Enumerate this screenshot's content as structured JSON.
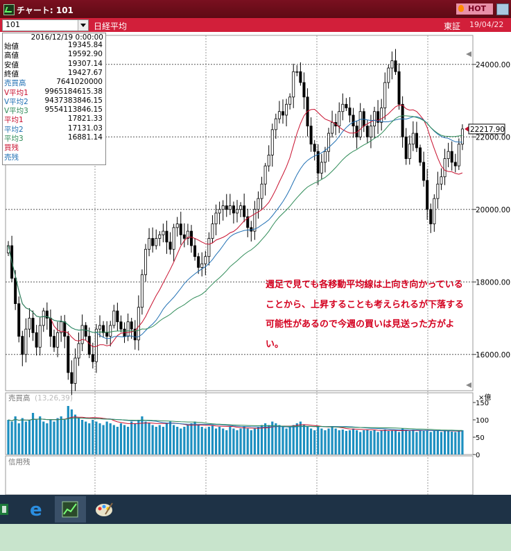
{
  "window": {
    "title": "チャート: 101",
    "hot_label": "HOT",
    "symbol_code": "101",
    "symbol_name": "日経平均",
    "exchange": "東証",
    "date": "19/04/22"
  },
  "info_box": {
    "datetime": "2016/12/19  0:00:00",
    "rows": [
      {
        "label": "始値",
        "value": "19345.84",
        "color": "#000000"
      },
      {
        "label": "高値",
        "value": "19592.90",
        "color": "#000000"
      },
      {
        "label": "安値",
        "value": "19307.14",
        "color": "#000000"
      },
      {
        "label": "終値",
        "value": "19427.67",
        "color": "#000000"
      },
      {
        "label": "売買高",
        "value": "7641020000",
        "color": "#1f6fb3"
      },
      {
        "label": "V平均1",
        "value": "9965184615.38",
        "color": "#c8102e"
      },
      {
        "label": "V平均2",
        "value": "9437383846.15",
        "color": "#1f6fb3"
      },
      {
        "label": "V平均3",
        "value": "9554113846.15",
        "color": "#2e8b57"
      },
      {
        "label": "平均1",
        "value": "17821.33",
        "color": "#c8102e"
      },
      {
        "label": "平均2",
        "value": "17131.03",
        "color": "#1f6fb3"
      },
      {
        "label": "平均3",
        "value": "16881.14",
        "color": "#2e8b57"
      },
      {
        "label": "買残",
        "value": "",
        "color": "#c8102e"
      },
      {
        "label": "売残",
        "value": "",
        "color": "#1f6fb3"
      }
    ]
  },
  "price_axis": {
    "ticks": [
      "24000.00",
      "22000.00",
      "20000.00",
      "18000.00",
      "16000.00"
    ],
    "current_price": "22217.90"
  },
  "volume_pane": {
    "label": "売買高",
    "params": "(13,26,39)",
    "unit": "×億",
    "ticks": [
      "150",
      "100",
      "50",
      "0"
    ]
  },
  "margin_pane": {
    "label": "信用残"
  },
  "annotation": "週足で見ても各移動平均線は上向き向かっていることから、上昇することも考えられるが下落する可能性があるので今週の買いは見送った方がよい。",
  "taskbar": {
    "icons": [
      "spreadsheet-app-icon",
      "edge-browser-icon",
      "chart-app-icon",
      "paint-app-icon"
    ]
  },
  "colors": {
    "title_bar": "#6e0e1a",
    "header_bar": "#d21f3a",
    "candle": "#000000",
    "ma1": "#c8102e",
    "ma2": "#1f6fb3",
    "ma3": "#2e8b57",
    "volume_bar": "#1c8fc0",
    "annotation": "#d4001f"
  },
  "chart_data": {
    "type": "candlestick",
    "x_unit": "week",
    "x_range": [
      "2016-01",
      "2019-04-22"
    ],
    "ylim": [
      15000,
      24800
    ],
    "close": [
      19000,
      18100,
      17400,
      16500,
      16000,
      16700,
      17000,
      16600,
      16200,
      16800,
      17200,
      17000,
      16500,
      16200,
      16600,
      16900,
      16500,
      15500,
      15200,
      15900,
      16300,
      16800,
      16500,
      16000,
      15800,
      16700,
      16800,
      16600,
      16500,
      16800,
      17200,
      16900,
      16700,
      16500,
      16900,
      16700,
      16400,
      17300,
      18200,
      18900,
      19200,
      19000,
      19200,
      19300,
      19400,
      19100,
      18900,
      19500,
      19600,
      19300,
      19200,
      19400,
      19000,
      18700,
      18400,
      18500,
      18700,
      19200,
      19600,
      19900,
      20000,
      20100,
      20000,
      20100,
      19900,
      20000,
      20100,
      19800,
      19500,
      19400,
      20000,
      20300,
      20700,
      21200,
      21500,
      22200,
      22500,
      22700,
      22600,
      22900,
      23100,
      23800,
      23800,
      23500,
      23100,
      22300,
      21800,
      21600,
      21000,
      21300,
      21600,
      22100,
      22400,
      22300,
      22700,
      22900,
      22800,
      22600,
      22300,
      22000,
      22700,
      22300,
      22000,
      22300,
      22700,
      22400,
      22800,
      23500,
      23900,
      24100,
      23800,
      22900,
      22000,
      21400,
      21800,
      22100,
      21700,
      21300,
      20800,
      20000,
      19600,
      20300,
      20700,
      20900,
      21400,
      21600,
      21300,
      21200,
      21800,
      22217.9
    ],
    "sma_periods": [
      13,
      26,
      39
    ],
    "volume_unit": "億株",
    "volume": [
      100,
      95,
      110,
      90,
      105,
      95,
      100,
      120,
      100,
      110,
      95,
      90,
      100,
      95,
      105,
      110,
      100,
      140,
      130,
      115,
      105,
      100,
      95,
      90,
      100,
      95,
      90,
      85,
      95,
      90,
      85,
      80,
      90,
      85,
      80,
      95,
      90,
      100,
      110,
      95,
      90,
      85,
      80,
      85,
      80,
      90,
      95,
      85,
      80,
      75,
      80,
      85,
      90,
      95,
      85,
      80,
      75,
      80,
      85,
      75,
      80,
      75,
      70,
      80,
      75,
      70,
      75,
      80,
      75,
      70,
      75,
      80,
      85,
      90,
      85,
      95,
      90,
      85,
      80,
      75,
      80,
      85,
      90,
      95,
      85,
      80,
      75,
      70,
      80,
      75,
      70,
      75,
      80,
      75,
      70,
      72,
      68,
      70,
      75,
      70,
      65,
      70,
      72,
      68,
      70,
      65,
      70,
      72,
      68,
      70,
      70,
      65,
      75,
      70,
      68,
      72,
      65,
      70,
      68,
      70,
      65,
      68,
      70,
      65,
      68,
      70,
      66,
      65,
      68,
      70
    ]
  }
}
